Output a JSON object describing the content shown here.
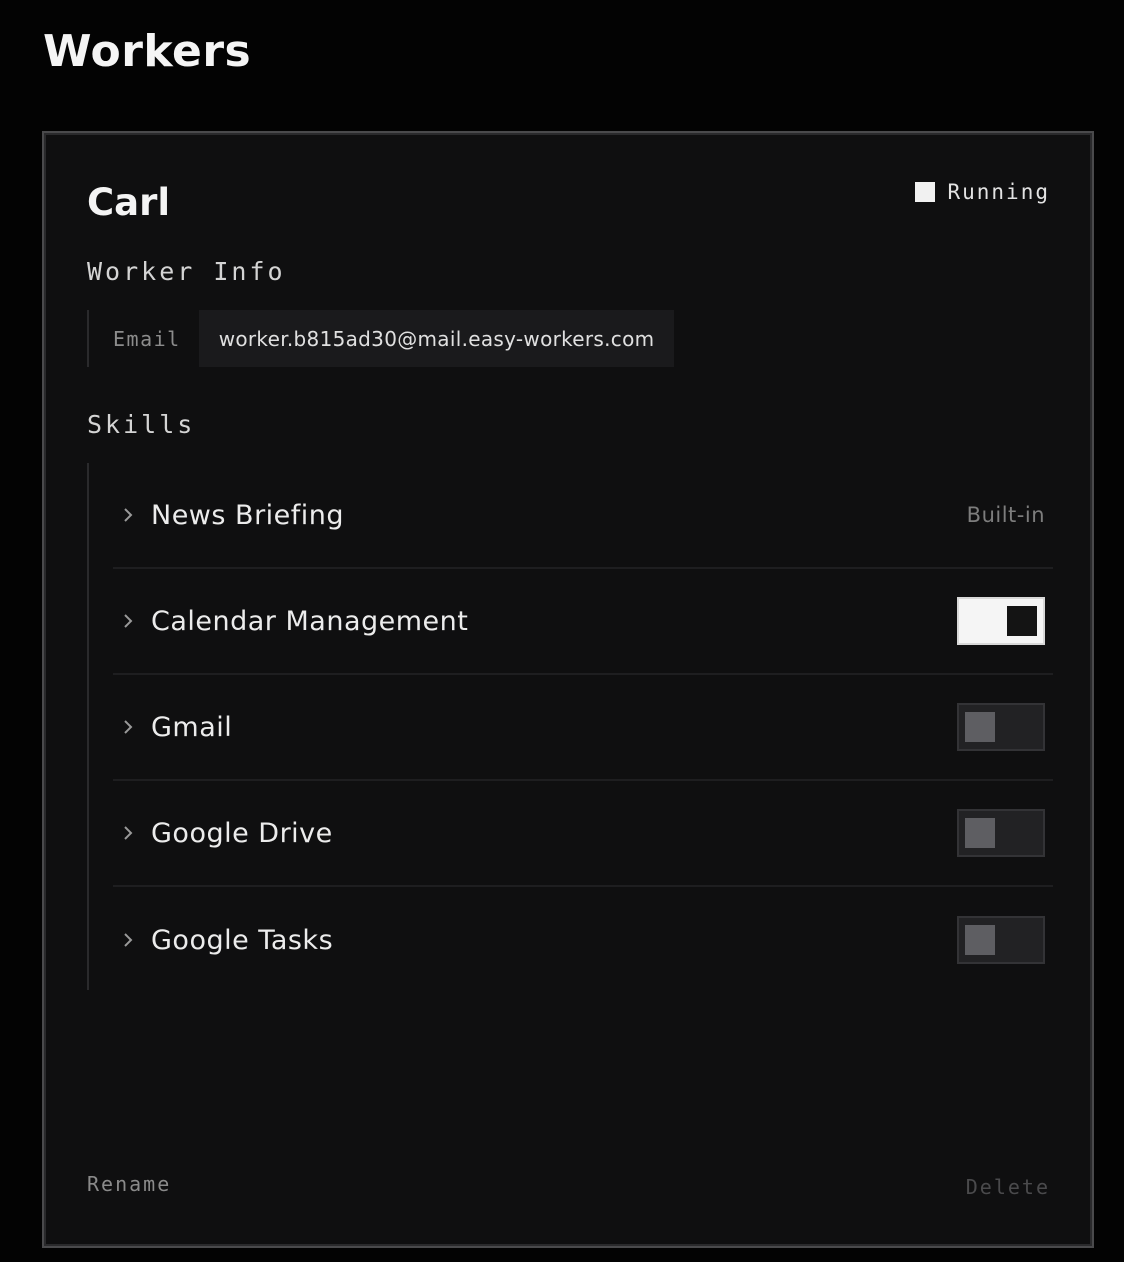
{
  "page": {
    "title": "Workers"
  },
  "worker": {
    "name": "Carl",
    "status": "Running",
    "info_heading": "Worker Info",
    "email_label": "Email",
    "email_value": "worker.b815ad30@mail.easy-workers.com"
  },
  "skills": {
    "heading": "Skills",
    "items": [
      {
        "label": "News Briefing",
        "control": "badge",
        "badge": "Built-in"
      },
      {
        "label": "Calendar Management",
        "control": "toggle",
        "enabled": true
      },
      {
        "label": "Gmail",
        "control": "toggle",
        "enabled": false
      },
      {
        "label": "Google Drive",
        "control": "toggle",
        "enabled": false
      },
      {
        "label": "Google Tasks",
        "control": "toggle",
        "enabled": false
      }
    ]
  },
  "actions": {
    "rename": "Rename",
    "delete": "Delete"
  },
  "colors": {
    "background": "#030303",
    "card": "#0f0f10",
    "toggle_on": "#f5f5f5",
    "toggle_off": "#222224"
  },
  "icons": {
    "status": "square-icon",
    "expand": "chevron-right-icon"
  }
}
